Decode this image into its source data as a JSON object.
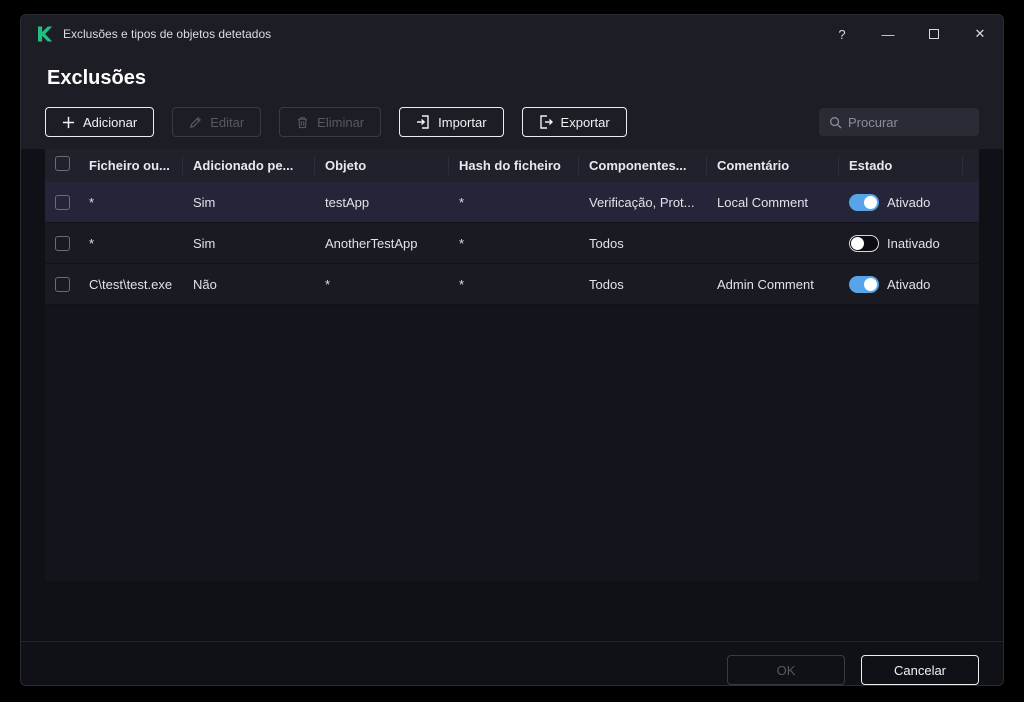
{
  "window": {
    "title": "Exclusões e tipos de objetos detetados",
    "controls": {
      "help": "?",
      "minimize": "—",
      "close": "✕"
    }
  },
  "page": {
    "title": "Exclusões"
  },
  "toolbar": {
    "add": "Adicionar",
    "edit": "Editar",
    "delete": "Eliminar",
    "import": "Importar",
    "export": "Exportar",
    "search_placeholder": "Procurar"
  },
  "table": {
    "headers": {
      "file": "Ficheiro ou...",
      "added": "Adicionado pe...",
      "object": "Objeto",
      "hash": "Hash do ficheiro",
      "components": "Componentes...",
      "comment": "Comentário",
      "state": "Estado"
    },
    "rows": [
      {
        "file": "*",
        "added": "Sim",
        "object": "testApp",
        "hash": "*",
        "components": "Verificação, Prot...",
        "comment": "Local Comment",
        "state": "Ativado",
        "enabled": true,
        "selected": true
      },
      {
        "file": "*",
        "added": "Sim",
        "object": "AnotherTestApp",
        "hash": "*",
        "components": "Todos",
        "comment": "",
        "state": "Inativado",
        "enabled": false,
        "selected": false
      },
      {
        "file": "C\\test\\test.exe",
        "added": "Não",
        "object": "*",
        "hash": "*",
        "components": "Todos",
        "comment": "Admin Comment",
        "state": "Ativado",
        "enabled": true,
        "selected": false
      }
    ]
  },
  "footer": {
    "ok": "OK",
    "cancel": "Cancelar"
  },
  "colors": {
    "brand_green": "#20BE83",
    "toggle_on": "#57a4e8"
  }
}
